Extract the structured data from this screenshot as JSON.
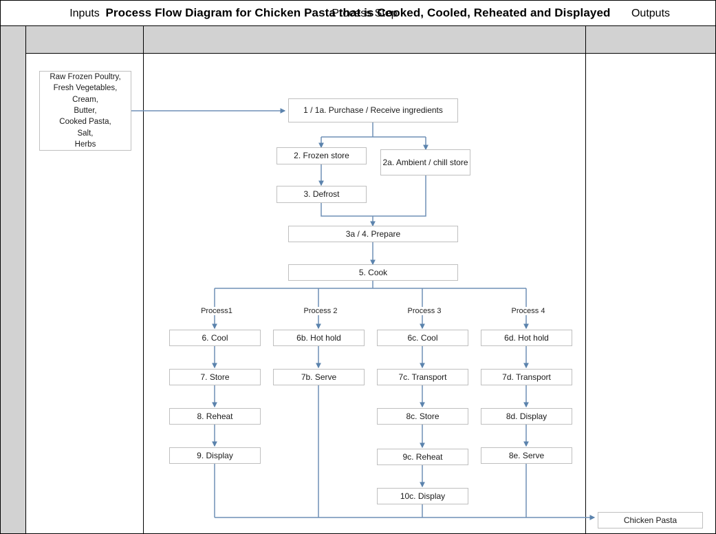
{
  "title": "Process Flow Diagram for Chicken Pasta that is Cooked, Cooled, Reheated and Displayed",
  "columns": {
    "inputs": "Inputs",
    "process": "Process Step",
    "outputs": "Outputs"
  },
  "colors": {
    "header_fill": "#d2d2d2",
    "gutter_fill": "#d2d2d2",
    "frame_border": "#000000",
    "box_border": "#bfbfbf",
    "connector": "#6e8fb5"
  },
  "inputs_box": {
    "lines": [
      "Raw Frozen Poultry,",
      "Fresh Vegetables,",
      "Cream,",
      "Butter,",
      "Cooked Pasta,",
      "Salt,",
      "Herbs"
    ]
  },
  "output_box": {
    "label": "Chicken Pasta"
  },
  "branch_labels": [
    "Process1",
    "Process 2",
    "Process 3",
    "Process 4"
  ],
  "steps": {
    "purchase": "1 / 1a. Purchase / Receive ingredients",
    "frozen_store": "2. Frozen store",
    "ambient_store": "2a. Ambient / chill store",
    "defrost": "3. Defrost",
    "prepare": "3a / 4. Prepare",
    "cook": "5. Cook",
    "p1_6": "6. Cool",
    "p1_7": "7. Store",
    "p1_8": "8. Reheat",
    "p1_9": "9. Display",
    "p2_6": "6b. Hot hold",
    "p2_7": "7b. Serve",
    "p3_6": "6c. Cool",
    "p3_7": "7c. Transport",
    "p3_8": "8c. Store",
    "p3_9": "9c. Reheat",
    "p3_10": "10c. Display",
    "p4_6": "6d. Hot hold",
    "p4_7": "7d. Transport",
    "p4_8": "8d. Display",
    "p4_9": "8e. Serve"
  }
}
